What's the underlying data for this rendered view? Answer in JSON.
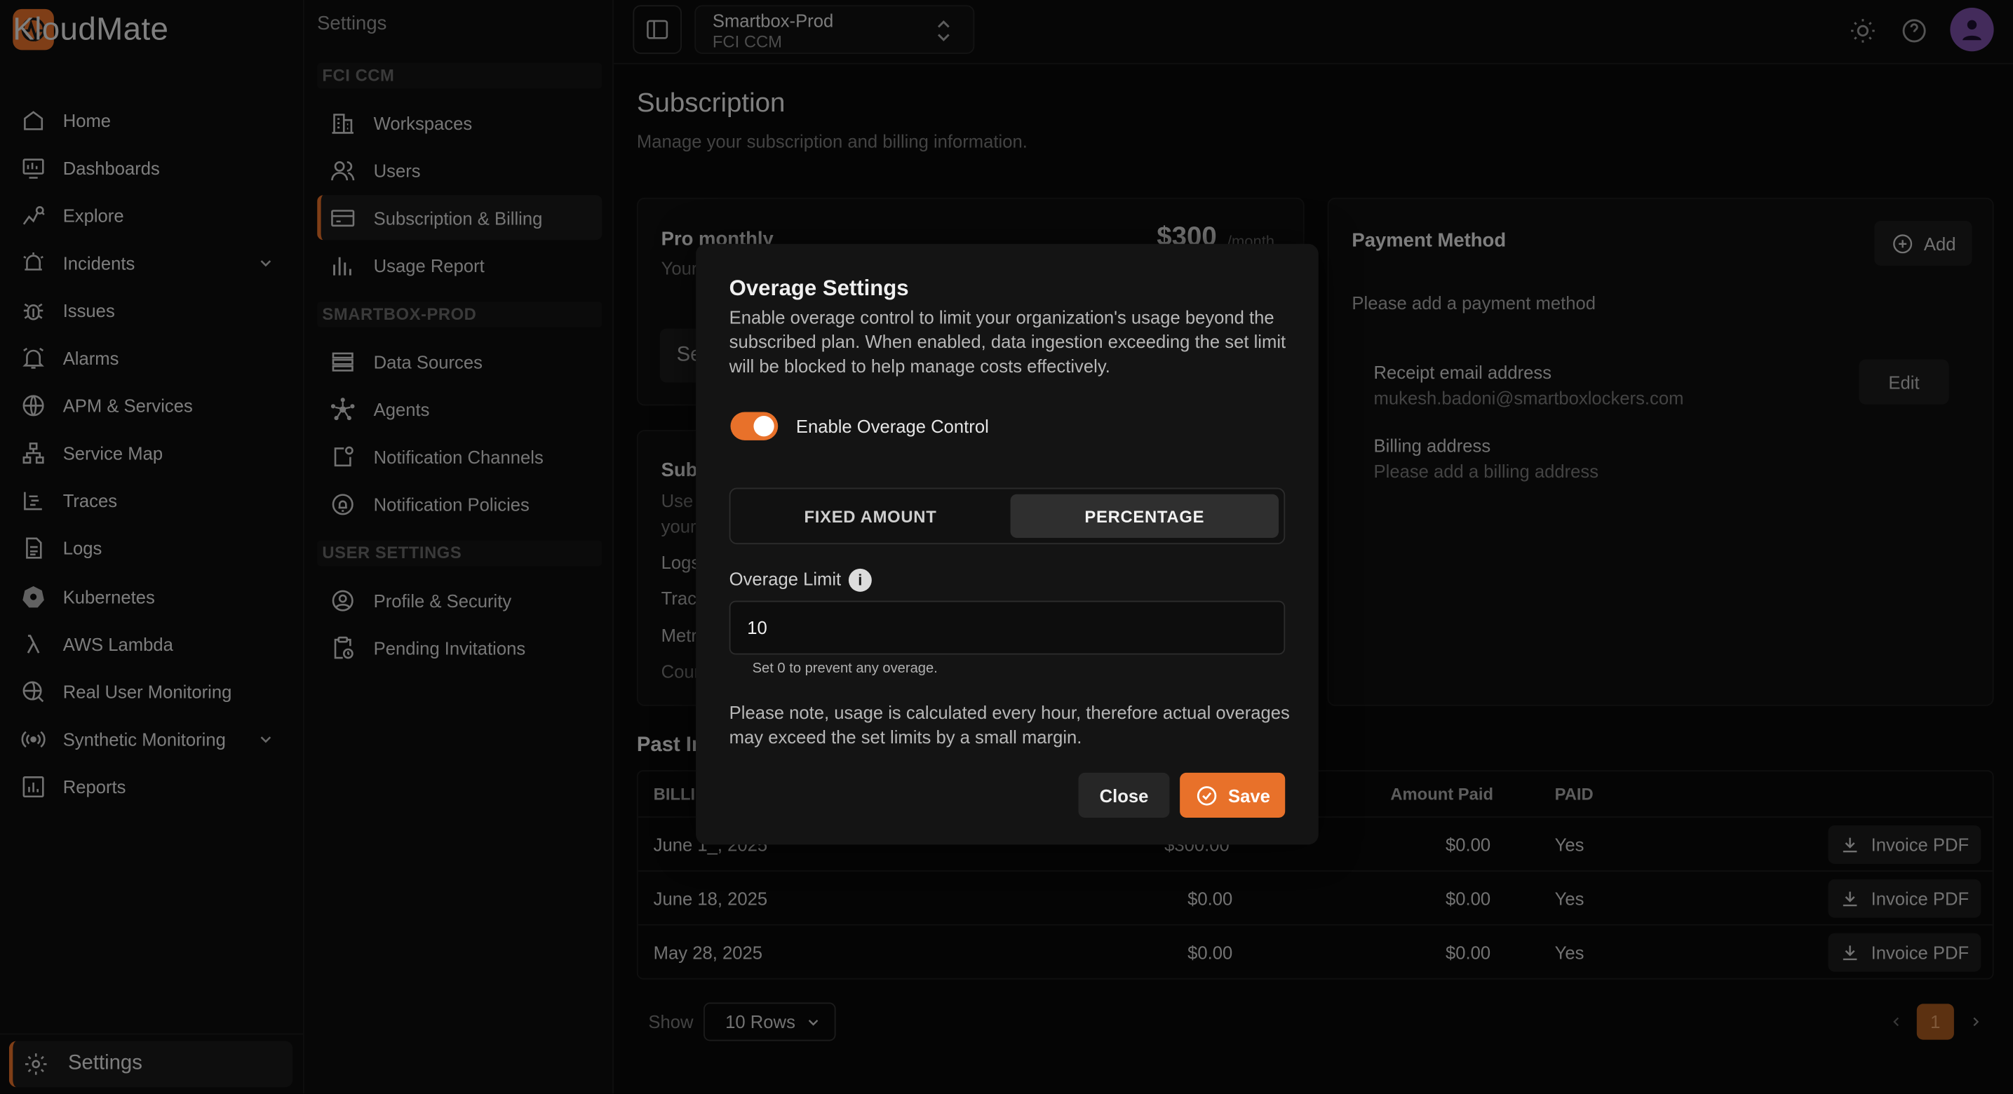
{
  "app": {
    "name": "KloudMate",
    "accent": "#e8712a"
  },
  "nav": {
    "items": [
      {
        "label": "Home",
        "icon": "home-icon"
      },
      {
        "label": "Dashboards",
        "icon": "dashboard-icon"
      },
      {
        "label": "Explore",
        "icon": "explore-icon"
      },
      {
        "label": "Incidents",
        "icon": "incidents-icon"
      },
      {
        "label": "Issues",
        "icon": "bug-icon"
      },
      {
        "label": "Alarms",
        "icon": "alarm-icon"
      },
      {
        "label": "APM & Services",
        "icon": "globe-icon"
      },
      {
        "label": "Service Map",
        "icon": "service-map-icon"
      },
      {
        "label": "Traces",
        "icon": "traces-icon"
      },
      {
        "label": "Logs",
        "icon": "logs-icon"
      },
      {
        "label": "Kubernetes",
        "icon": "kubernetes-icon"
      },
      {
        "label": "AWS Lambda",
        "icon": "lambda-icon"
      },
      {
        "label": "Real User Monitoring",
        "icon": "rum-icon"
      },
      {
        "label": "Synthetic Monitoring",
        "icon": "synthetic-icon"
      },
      {
        "label": "Reports",
        "icon": "reports-icon"
      }
    ],
    "settings": "Settings"
  },
  "sub": {
    "title": "Settings",
    "sections": [
      "FCI CCM",
      "SMARTBOX-PROD",
      "USER SETTINGS"
    ],
    "items": [
      "Workspaces",
      "Users",
      "Subscription & Billing",
      "Usage Report",
      "Data Sources",
      "Agents",
      "Notification Channels",
      "Notification Policies",
      "Profile & Security",
      "Pending Invitations"
    ]
  },
  "header": {
    "workspace": "Smartbox-Prod",
    "org": "FCI CCM"
  },
  "page": {
    "title": "Subscription",
    "subtitle": "Manage your subscription and billing information."
  },
  "plan": {
    "name": "Pro monthly",
    "price": "$300",
    "per": "/month",
    "line1": "Your",
    "btn": "Se"
  },
  "usage_card": {
    "title": "Sub",
    "desc1": "Use",
    "desc2": "your",
    "rows": [
      "Logs",
      "Trac",
      "Metr",
      "Cour"
    ]
  },
  "payment": {
    "title": "Payment Method",
    "add": "Add",
    "empty": "Please add a payment method",
    "receipt_label": "Receipt email address",
    "receipt_value": "mukesh.badoni@smartboxlockers.com",
    "edit": "Edit",
    "billing_label": "Billing address",
    "billing_value": "Please add a billing address"
  },
  "invoices": {
    "title": "Past In",
    "headers": {
      "period": "BILLI",
      "amount_paid": "Amount Paid",
      "paid": "PAID"
    },
    "rows": [
      {
        "date": "June 1_, 2025",
        "amount": "$300.00",
        "amount_paid": "$0.00",
        "paid": "Yes",
        "action": "Invoice PDF"
      },
      {
        "date": "June 18, 2025",
        "amount": "$0.00",
        "amount_paid": "$0.00",
        "paid": "Yes",
        "action": "Invoice PDF"
      },
      {
        "date": "May 28, 2025",
        "amount": "$0.00",
        "amount_paid": "$0.00",
        "paid": "Yes",
        "action": "Invoice PDF"
      }
    ],
    "show_label": "Show",
    "rows_per_page": "10 Rows",
    "page": "1"
  },
  "modal": {
    "title": "Overage Settings",
    "description": "Enable overage control to limit your organization's usage beyond the subscribed plan. When enabled, data ingestion exceeding the set limit will be blocked to help manage costs effectively.",
    "toggle_label": "Enable Overage Control",
    "toggle_on": true,
    "mode_fixed": "FIXED AMOUNT",
    "mode_percentage": "PERCENTAGE",
    "selected_mode": "PERCENTAGE",
    "limit_label": "Overage Limit",
    "limit_value": "10",
    "hint": "Set 0 to prevent any overage.",
    "note": "Please note, usage is calculated every hour, therefore actual overages may exceed the set limits by a small margin.",
    "close": "Close",
    "save": "Save"
  }
}
